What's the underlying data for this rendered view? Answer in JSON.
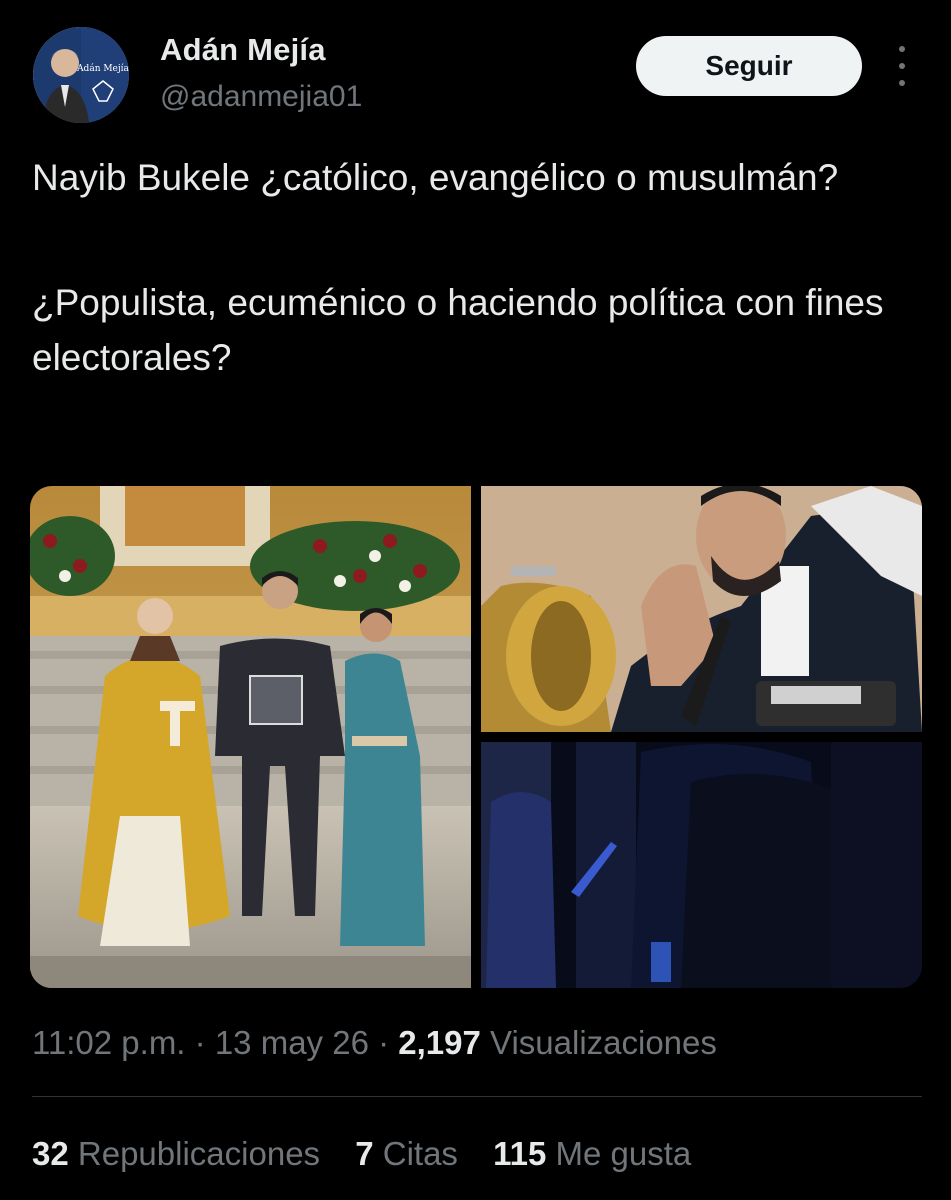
{
  "user": {
    "display_name": "Adán Mejía",
    "handle": "@adanmejia01",
    "avatar_text": "Adán Mejía"
  },
  "follow_button": {
    "label": "Seguir"
  },
  "more_icon": "more-options-icon",
  "tweet": {
    "paragraphs": [
      "Nayib Bukele ¿católico, evangélico o musulmán?",
      "¿Populista, ecuménico o haciendo política con fines electorales?"
    ]
  },
  "media": {
    "count": 3,
    "images": [
      "church-ceremony-photo",
      "praying-photo",
      "dark-event-photo"
    ]
  },
  "meta": {
    "time": "11:02 p.m.",
    "sep": "·",
    "date": "13 may 26",
    "views_count": "2,197",
    "views_label": "Visualizaciones"
  },
  "stats": {
    "reposts_count": "32",
    "reposts_label": "Republicaciones",
    "quotes_count": "7",
    "quotes_label": "Citas",
    "likes_count": "115",
    "likes_label": "Me gusta"
  },
  "colors": {
    "background": "#000000",
    "text_primary": "#e7e9ea",
    "text_secondary": "#71767b",
    "button_bg": "#eff3f4",
    "divider": "#2f3336"
  }
}
